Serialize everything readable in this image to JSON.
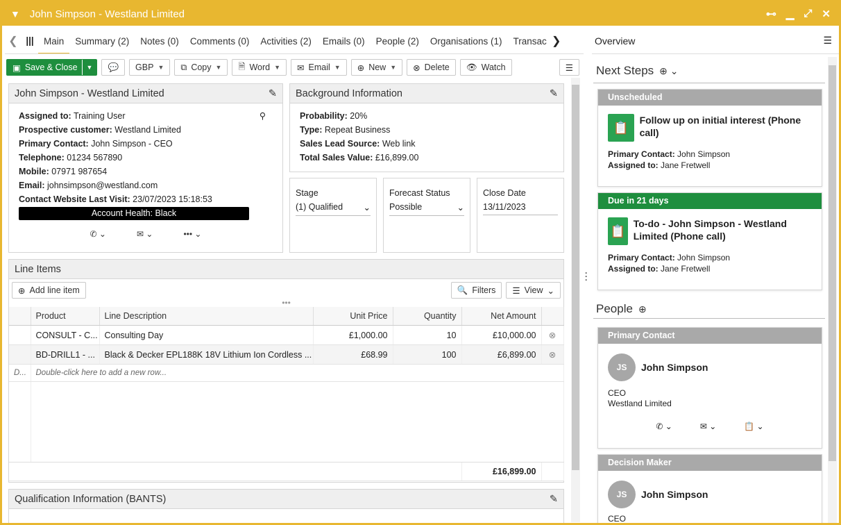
{
  "window": {
    "title": "John Simpson - Westland Limited"
  },
  "tabs": [
    "Main",
    "Summary (2)",
    "Notes (0)",
    "Comments (0)",
    "Activities (2)",
    "Emails (0)",
    "People (2)",
    "Organisations (1)",
    "Transac"
  ],
  "toolbar": {
    "save": "Save & Close",
    "currency": "GBP",
    "copy": "Copy",
    "word": "Word",
    "email": "Email",
    "new": "New",
    "delete": "Delete",
    "watch": "Watch"
  },
  "contact": {
    "title": "John Simpson - Westland Limited",
    "assigned_label": "Assigned to:",
    "assigned": "Training User",
    "prospect_label": "Prospective customer:",
    "prospect": "Westland Limited",
    "primary_label": "Primary Contact:",
    "primary": "John Simpson - CEO",
    "tel_label": "Telephone:",
    "tel": "01234 567890",
    "mob_label": "Mobile:",
    "mob": "07971 987654",
    "email_label": "Email:",
    "email": "johnsimpson@westland.com",
    "visit_label": "Contact Website Last Visit:",
    "visit": "23/07/2023 15:18:53",
    "health": "Account Health: Black"
  },
  "background": {
    "title": "Background Information",
    "prob_label": "Probability:",
    "prob": "20%",
    "type_label": "Type:",
    "type": "Repeat Business",
    "source_label": "Sales Lead Source:",
    "source": "Web link",
    "total_label": "Total Sales Value:",
    "total": "£16,899.00"
  },
  "stage": {
    "label": "Stage",
    "value": "(1) Qualified"
  },
  "forecast": {
    "label": "Forecast Status",
    "value": "Possible"
  },
  "close": {
    "label": "Close Date",
    "value": "13/11/2023"
  },
  "lineitems": {
    "title": "Line Items",
    "add": "Add line item",
    "filters": "Filters",
    "view": "View",
    "columns": [
      "Product",
      "Line Description",
      "Unit Price",
      "Quantity",
      "Net Amount"
    ],
    "rows": [
      {
        "product": "CONSULT - C...",
        "desc": "Consulting Day",
        "price": "£1,000.00",
        "qty": "10",
        "net": "£10,000.00"
      },
      {
        "product": "BD-DRILL1 - ...",
        "desc": "Black & Decker EPL188K 18V Lithium Ion Cordless ...",
        "price": "£68.99",
        "qty": "100",
        "net": "£6,899.00"
      }
    ],
    "newrow_prefix": "D...",
    "newrow": "Double-click here to add a new row...",
    "total": "£16,899.00"
  },
  "qualification": {
    "title": "Qualification Information (BANTS)"
  },
  "overview": {
    "title": "Overview",
    "next_steps": "Next Steps",
    "people": "People",
    "steps": [
      {
        "header": "Unscheduled",
        "title": "Follow up on initial interest (Phone call)",
        "contact": "John Simpson",
        "assigned": "Jane Fretwell"
      },
      {
        "header": "Due in 21 days",
        "title": "To-do - John Simpson - Westland Limited (Phone call)",
        "contact": "John Simpson",
        "assigned": "Jane Fretwell"
      }
    ],
    "contact_label": "Primary Contact:",
    "assigned_label": "Assigned to:",
    "persons": [
      {
        "header": "Primary Contact",
        "initials": "JS",
        "name": "John Simpson",
        "role": "CEO",
        "org": "Westland Limited"
      },
      {
        "header": "Decision Maker",
        "initials": "JS",
        "name": "John Simpson",
        "role": "CEO"
      }
    ]
  },
  "colors": {
    "accent": "#e8b730",
    "green": "#1e8e3e",
    "grey_header": "#a9a9a9"
  }
}
